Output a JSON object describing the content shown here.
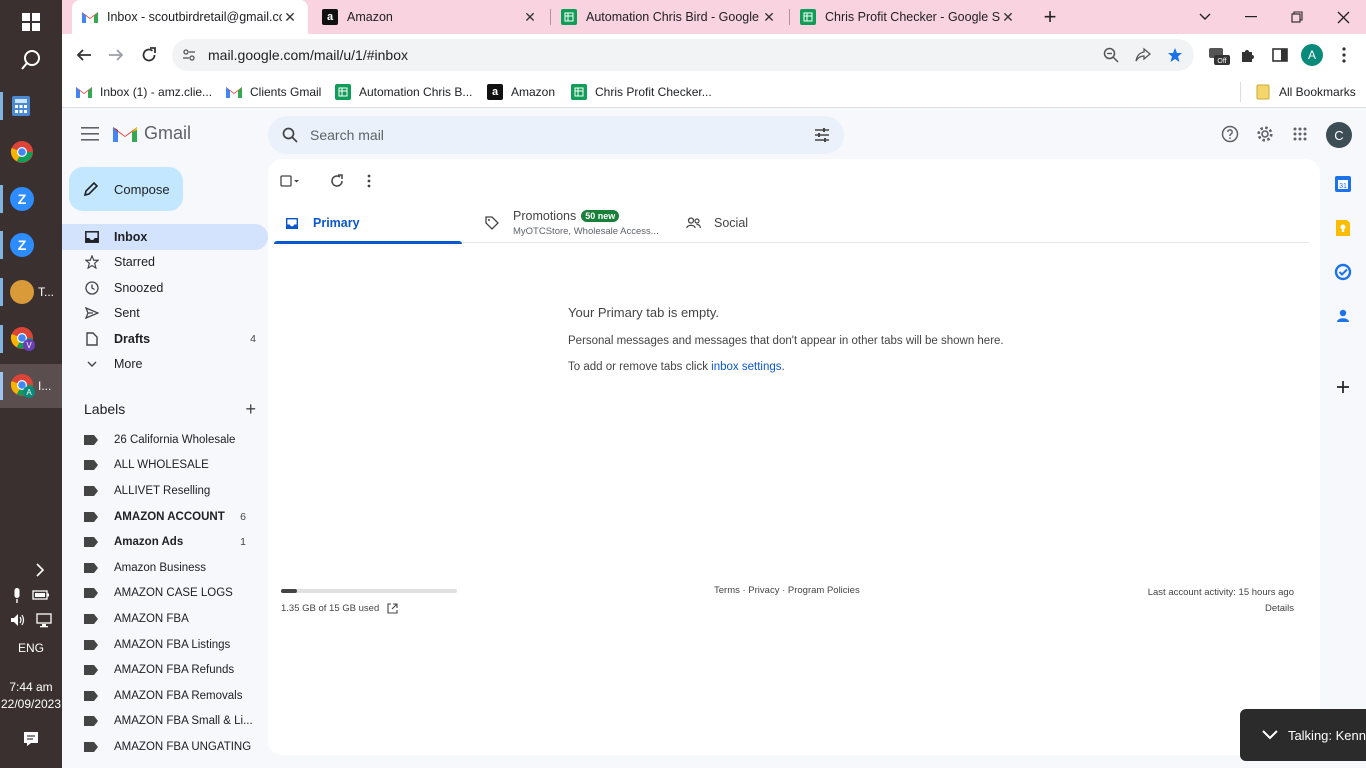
{
  "taskbar": {
    "apps": [
      {
        "label": "",
        "icon": "calculator-icon"
      },
      {
        "label": "",
        "icon": "chrome-icon"
      },
      {
        "label": "",
        "icon": "zoom-icon"
      },
      {
        "label": "",
        "icon": "zoom-icon"
      },
      {
        "label": "T...",
        "icon": "avatar-icon"
      },
      {
        "label": "",
        "icon": "chrome-profile-v-icon"
      },
      {
        "label": "I...",
        "icon": "chrome-profile-a-icon"
      }
    ],
    "language": "ENG",
    "time": "7:44 am",
    "date": "22/09/2023"
  },
  "browser": {
    "tabs": [
      {
        "title": "Inbox - scoutbirdretail@gmail.com",
        "icon": "gmail-icon",
        "active": true
      },
      {
        "title": "Amazon",
        "icon": "amazon-icon",
        "active": false
      },
      {
        "title": "Automation Chris Bird - Google Sheets",
        "icon": "sheets-icon",
        "active": false
      },
      {
        "title": "Chris Profit Checker - Google Sheets",
        "icon": "sheets-icon",
        "active": false
      }
    ],
    "url": "mail.google.com/mail/u/1/#inbox",
    "profile_initial": "A",
    "bookmarks": [
      {
        "label": "Inbox (1) - amz.clie...",
        "icon": "gmail-icon"
      },
      {
        "label": "Clients Gmail",
        "icon": "gmail-icon"
      },
      {
        "label": "Automation Chris B...",
        "icon": "sheets-icon"
      },
      {
        "label": "Amazon",
        "icon": "amazon-icon"
      },
      {
        "label": "Chris Profit Checker...",
        "icon": "sheets-icon"
      }
    ],
    "all_bookmarks": "All Bookmarks"
  },
  "gmail": {
    "brand": "Gmail",
    "search_placeholder": "Search mail",
    "account_initial": "C",
    "compose_label": "Compose",
    "nav": [
      {
        "label": "Inbox",
        "icon": "inbox-icon",
        "count": "",
        "selected": true
      },
      {
        "label": "Starred",
        "icon": "star-icon",
        "count": ""
      },
      {
        "label": "Snoozed",
        "icon": "clock-icon",
        "count": ""
      },
      {
        "label": "Sent",
        "icon": "send-icon",
        "count": ""
      },
      {
        "label": "Drafts",
        "icon": "draft-icon",
        "count": "4"
      },
      {
        "label": "More",
        "icon": "chevron-down-icon",
        "count": ""
      }
    ],
    "labels_title": "Labels",
    "labels": [
      {
        "label": "26 California Wholesale",
        "count": ""
      },
      {
        "label": "ALL WHOLESALE",
        "count": ""
      },
      {
        "label": "ALLIVET Reselling",
        "count": ""
      },
      {
        "label": "AMAZON ACCOUNT",
        "count": "6",
        "bold": true
      },
      {
        "label": "Amazon Ads",
        "count": "1",
        "bold": true
      },
      {
        "label": "Amazon Business",
        "count": ""
      },
      {
        "label": "AMAZON CASE LOGS",
        "count": ""
      },
      {
        "label": "AMAZON FBA",
        "count": ""
      },
      {
        "label": "AMAZON FBA Listings",
        "count": ""
      },
      {
        "label": "AMAZON FBA Refunds",
        "count": ""
      },
      {
        "label": "AMAZON FBA Removals",
        "count": ""
      },
      {
        "label": "AMAZON FBA Small & Li...",
        "count": ""
      },
      {
        "label": "AMAZON FBA UNGATING",
        "count": ""
      }
    ],
    "tabs": [
      {
        "label": "Primary",
        "icon": "inbox-tab-icon",
        "selected": true
      },
      {
        "label": "Promotions",
        "badge": "50 new",
        "subtitle": "MyOTCStore, Wholesale Access...",
        "icon": "tag-icon"
      },
      {
        "label": "Social",
        "icon": "people-icon"
      }
    ],
    "empty": {
      "title": "Your Primary tab is empty.",
      "line1": "Personal messages and messages that don't appear in other tabs will be shown here.",
      "line2_prefix": "To add or remove tabs click ",
      "line2_link": "inbox settings",
      "line2_suffix": "."
    },
    "storage": {
      "text": "1.35 GB of 15 GB used",
      "fraction": 0.09
    },
    "footer_links": "Terms · Privacy · Program Policies",
    "last_activity": "Last account activity: 15 hours ago",
    "details": "Details"
  },
  "talking": "Talking: Kenn",
  "colors": {
    "accent": "#0b57d0",
    "compose": "#c2e7ff",
    "selected_nav": "#d3e3fd",
    "badge": "#188038",
    "tab_strip": "#f9d3e0"
  }
}
